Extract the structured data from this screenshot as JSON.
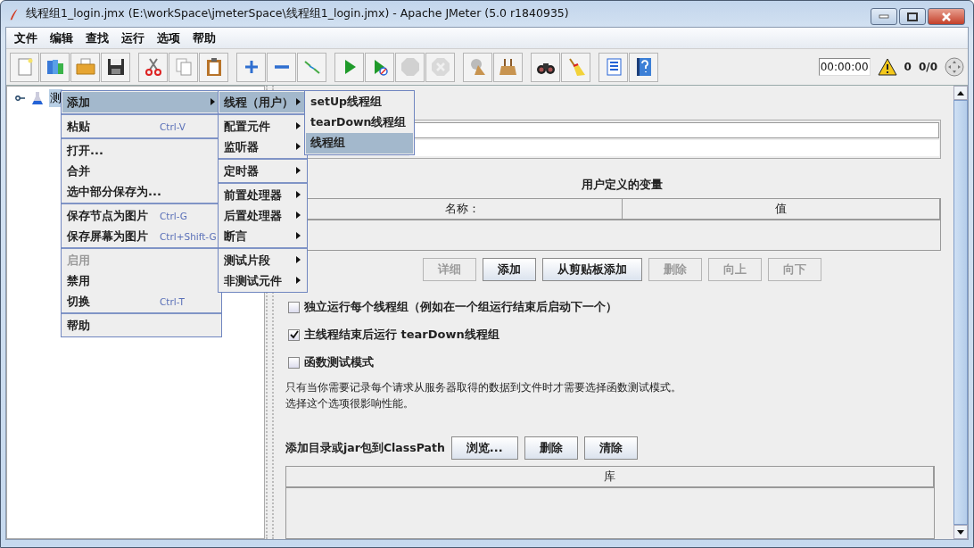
{
  "window": {
    "title": "线程组1_login.jmx (E:\\workSpace\\jmeterSpace\\线程组1_login.jmx) - Apache JMeter (5.0 r1840935)"
  },
  "menu_bar": [
    "文件",
    "编辑",
    "查找",
    "运行",
    "选项",
    "帮助"
  ],
  "toolbar": {
    "groups": [
      [
        {
          "disabled": false
        },
        {
          "disabled": false
        },
        {
          "disabled": false
        },
        {
          "disabled": false
        }
      ],
      [
        {
          "disabled": false
        },
        {
          "disabled": false
        },
        {
          "disabled": false
        }
      ],
      [
        {
          "disabled": false
        },
        {
          "disabled": false
        },
        {
          "disabled": false
        }
      ],
      [
        {
          "disabled": false
        },
        {
          "disabled": false
        },
        {
          "disabled": true
        },
        {
          "disabled": true
        }
      ],
      [
        {
          "disabled": false
        },
        {
          "disabled": false
        }
      ],
      [
        {
          "disabled": false
        },
        {
          "disabled": false
        }
      ],
      [
        {
          "disabled": false
        },
        {
          "disabled": false
        }
      ]
    ],
    "timer": "00:00:00",
    "warning_count": "0",
    "threads": "0/0"
  },
  "tree": {
    "items": [
      {
        "label": "测",
        "selected": true
      }
    ]
  },
  "context_menu": [
    [
      {
        "label": "添加",
        "selected": true,
        "disabled": false,
        "has_submenu": true
      }
    ],
    [
      {
        "label": "粘贴",
        "shortcut": "Ctrl-V",
        "selected": false,
        "disabled": false,
        "has_submenu": false
      }
    ],
    [
      {
        "label": "打开...",
        "selected": false,
        "disabled": false,
        "has_submenu": false
      },
      {
        "label": "合并",
        "selected": false,
        "disabled": false,
        "has_submenu": false
      },
      {
        "label": "选中部分保存为...",
        "selected": false,
        "disabled": false,
        "has_submenu": false
      }
    ],
    [
      {
        "label": "保存节点为图片",
        "shortcut": "Ctrl-G",
        "selected": false,
        "disabled": false,
        "has_submenu": false
      },
      {
        "label": "保存屏幕为图片",
        "shortcut": "Ctrl+Shift-G",
        "selected": false,
        "disabled": false,
        "has_submenu": false
      }
    ],
    [
      {
        "label": "启用",
        "selected": false,
        "disabled": true,
        "has_submenu": false
      },
      {
        "label": "禁用",
        "selected": false,
        "disabled": false,
        "has_submenu": false
      },
      {
        "label": "切换",
        "shortcut": "Ctrl-T",
        "selected": false,
        "disabled": false,
        "has_submenu": false
      }
    ],
    [
      {
        "label": "帮助",
        "selected": false,
        "disabled": false,
        "has_submenu": false
      }
    ]
  ],
  "add_submenu": [
    [
      {
        "label": "线程（用户）",
        "selected": true,
        "has_submenu": true
      }
    ],
    [
      {
        "label": "配置元件",
        "selected": false,
        "has_submenu": true
      },
      {
        "label": "监听器",
        "selected": false,
        "has_submenu": true
      }
    ],
    [
      {
        "label": "定时器",
        "selected": false,
        "has_submenu": true
      }
    ],
    [
      {
        "label": "前置处理器",
        "selected": false,
        "has_submenu": true
      },
      {
        "label": "后置处理器",
        "selected": false,
        "has_submenu": true
      },
      {
        "label": "断言",
        "selected": false,
        "has_submenu": true
      }
    ],
    [
      {
        "label": "测试片段",
        "selected": false,
        "has_submenu": true
      },
      {
        "label": "非测试元件",
        "selected": false,
        "has_submenu": true
      }
    ]
  ],
  "threads_submenu": [
    {
      "label": "setUp线程组",
      "selected": false
    },
    {
      "label": "tearDown线程组",
      "selected": false
    },
    {
      "label": "线程组",
      "selected": true
    }
  ],
  "variables": {
    "title": "用户定义的变量",
    "columns": [
      "名称：",
      "值"
    ]
  },
  "variable_buttons": [
    {
      "label": "详细",
      "disabled": true
    },
    {
      "label": "添加",
      "disabled": false
    },
    {
      "label": "从剪贴板添加",
      "disabled": false
    },
    {
      "label": "删除",
      "disabled": true
    },
    {
      "label": "向上",
      "disabled": true
    },
    {
      "label": "向下",
      "disabled": true
    }
  ],
  "options": [
    {
      "label": "独立运行每个线程组（例如在一个组运行结束后启动下一个）",
      "checked": false
    },
    {
      "label": "主线程结束后运行 tearDown线程组",
      "checked": true
    },
    {
      "label": "函数测试模式",
      "checked": false
    }
  ],
  "help_text": [
    "只有当你需要记录每个请求从服务器取得的数据到文件时才需要选择函数测试模式。",
    "选择这个选项很影响性能。"
  ],
  "classpath": {
    "label": "添加目录或jar包到ClassPath",
    "buttons": [
      "浏览...",
      "删除",
      "清除"
    ],
    "columns": [
      "库"
    ]
  }
}
